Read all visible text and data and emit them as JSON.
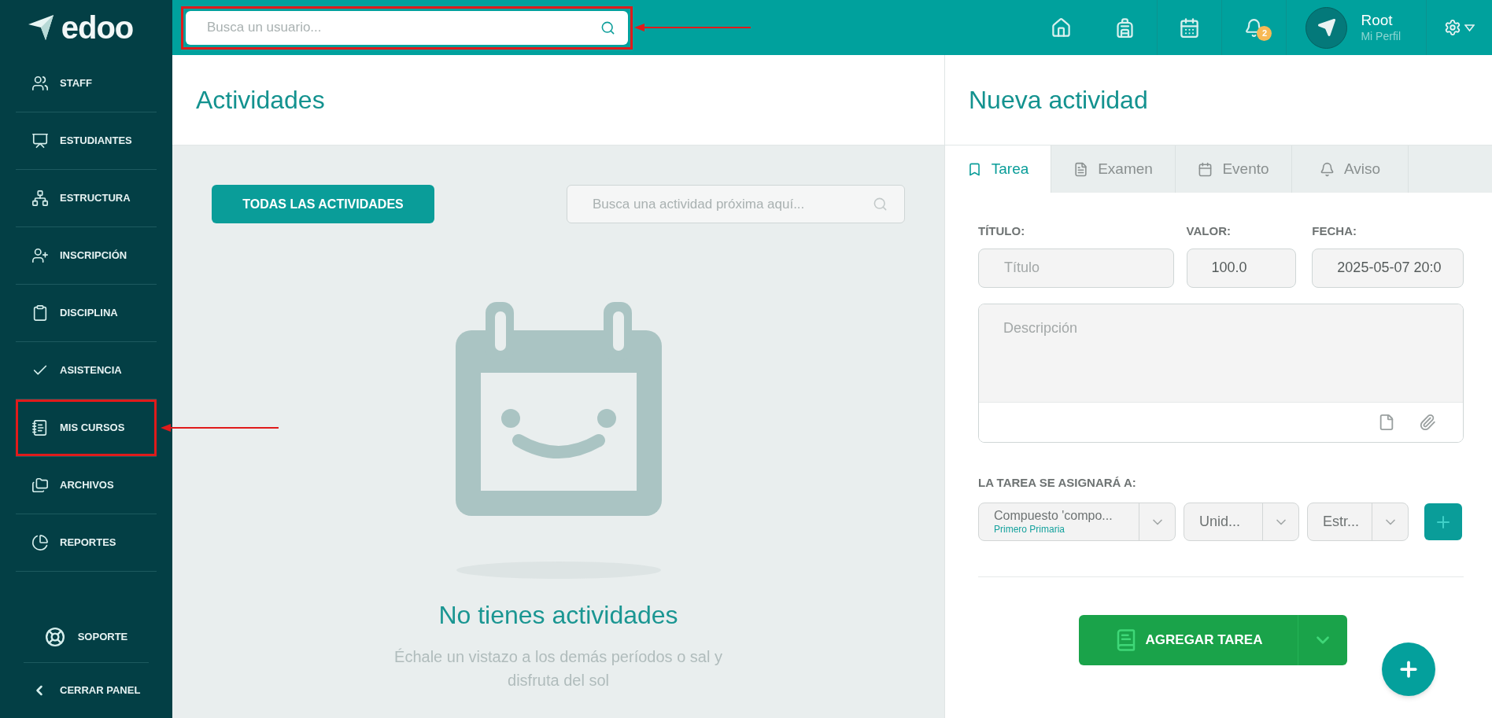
{
  "sidebar": {
    "logo": "edoo",
    "items": [
      {
        "label": "STAFF",
        "highlighted": false
      },
      {
        "label": "ESTUDIANTES",
        "highlighted": false
      },
      {
        "label": "ESTRUCTURA",
        "highlighted": false
      },
      {
        "label": "INSCRIPCIÓN",
        "highlighted": false
      },
      {
        "label": "DISCIPLINA",
        "highlighted": false
      },
      {
        "label": "ASISTENCIA",
        "highlighted": false
      },
      {
        "label": "MIS CURSOS",
        "highlighted": true
      },
      {
        "label": "ARCHIVOS",
        "highlighted": false
      },
      {
        "label": "REPORTES",
        "highlighted": false
      }
    ],
    "support": "SOPORTE",
    "collapse": "CERRAR PANEL"
  },
  "topbar": {
    "search": {
      "placeholder": "Busca un usuario...",
      "highlighted": true
    },
    "notifications_badge": "2",
    "user": {
      "name": "Root",
      "subtitle": "Mi Perfil"
    }
  },
  "activities": {
    "title": "Actividades",
    "filter_button": "TODAS LAS ACTIVIDADES",
    "search": {
      "placeholder": "Busca una actividad próxima aquí..."
    },
    "empty": {
      "title": "No tienes actividades",
      "message": "Échale un vistazo a los demás períodos o sal y disfruta del sol"
    }
  },
  "new_activity": {
    "title": "Nueva actividad",
    "tabs": [
      {
        "label": "Tarea",
        "selected": true
      },
      {
        "label": "Examen",
        "selected": false
      },
      {
        "label": "Evento",
        "selected": false
      },
      {
        "label": "Aviso",
        "selected": false
      }
    ],
    "title_field": {
      "label": "TÍTULO:",
      "placeholder": "Título"
    },
    "value_field": {
      "label": "VALOR:",
      "value": "100.0"
    },
    "date_field": {
      "label": "FECHA:",
      "value": "2025-05-07 20:0"
    },
    "description": {
      "placeholder": "Descripción"
    },
    "assign_label": "LA TAREA SE ASIGNARÁ A:",
    "selects": [
      {
        "value": "Compuesto 'compo...",
        "subtitle": "Primero Primaria"
      },
      {
        "value": "Unid..."
      },
      {
        "value": "Estr..."
      }
    ],
    "submit": "AGREGAR TAREA"
  }
}
